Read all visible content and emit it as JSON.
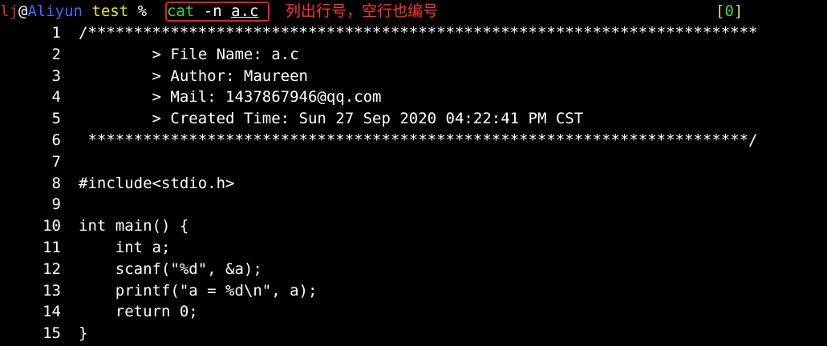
{
  "prompt": {
    "user": "lj",
    "at": "@",
    "host": "Aliyun",
    "dir": " test",
    "symbol": " %"
  },
  "command": {
    "name": "cat",
    "flag": " -n ",
    "arg": "a.c"
  },
  "annotation": "列出行号，空行也编号",
  "job": {
    "open": "[",
    "number": "0",
    "close": "]"
  },
  "lines": [
    {
      "n": "1",
      "text": "/*************************************************************************"
    },
    {
      "n": "2",
      "text": "        > File Name: a.c"
    },
    {
      "n": "3",
      "text": "        > Author: Maureen"
    },
    {
      "n": "4",
      "text": "        > Mail: 1437867946@qq.com"
    },
    {
      "n": "5",
      "text": "        > Created Time: Sun 27 Sep 2020 04:22:41 PM CST"
    },
    {
      "n": "6",
      "text": " ************************************************************************/"
    },
    {
      "n": "7",
      "text": ""
    },
    {
      "n": "8",
      "text": "#include<stdio.h>"
    },
    {
      "n": "9",
      "text": ""
    },
    {
      "n": "10",
      "text": "int main() {"
    },
    {
      "n": "11",
      "text": "    int a;"
    },
    {
      "n": "12",
      "text": "    scanf(\"%d\", &a);"
    },
    {
      "n": "13",
      "text": "    printf(\"a = %d\\n\", a);"
    },
    {
      "n": "14",
      "text": "    return 0;"
    },
    {
      "n": "15",
      "text": "}"
    }
  ],
  "colors": {
    "background": "#000000",
    "user": "#cc3333",
    "host": "#3d6bff",
    "dir": "#e8e43a",
    "command": "#46d23b",
    "annotation": "#ff3333",
    "highlight_box": "#e0202a"
  }
}
